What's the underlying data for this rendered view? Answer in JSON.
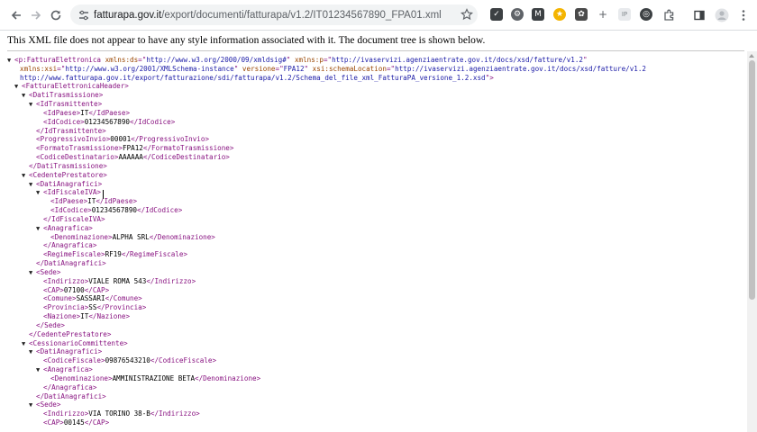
{
  "browser": {
    "url_host": "fatturapa.gov.it",
    "url_path": "/export/documenti/fatturapa/v1.2/IT01234567890_FPA01.xml",
    "icons": [
      "back-arrow-icon",
      "forward-arrow-icon",
      "reload-icon",
      "site-info-icon",
      "bookmark-star-icon",
      "extensions-puzzle-icon",
      "side-panel-icon",
      "profile-avatar-icon",
      "kebab-menu-icon"
    ]
  },
  "banner": {
    "message": "This XML file does not appear to have any style information associated with it. The document tree is shown below."
  },
  "xml": {
    "lines": [
      {
        "tw": "▼",
        "i": 0,
        "parts": [
          [
            "t",
            "<p:FatturaElettronica "
          ],
          [
            "n",
            "xmlns:ds"
          ],
          [
            "t",
            "=\""
          ],
          [
            "v",
            "http://www.w3.org/2000/09/xmldsig#"
          ],
          [
            "t",
            "\" "
          ],
          [
            "n",
            "xmlns:p"
          ],
          [
            "t",
            "=\""
          ],
          [
            "v",
            "http://ivaservizi.agenziaentrate.gov.it/docs/xsd/fatture/v1.2"
          ],
          [
            "t",
            "\""
          ]
        ]
      },
      {
        "tw": "",
        "i": 0,
        "parts": [
          [
            "n",
            "xmlns:xsi"
          ],
          [
            "t",
            "=\""
          ],
          [
            "v",
            "http://www.w3.org/2001/XMLSchema-instance"
          ],
          [
            "t",
            "\" "
          ],
          [
            "n",
            "versione"
          ],
          [
            "t",
            "=\""
          ],
          [
            "v",
            "FPA12"
          ],
          [
            "t",
            "\" "
          ],
          [
            "n",
            "xsi:schemaLocation"
          ],
          [
            "t",
            "=\""
          ],
          [
            "v",
            "http://ivaservizi.agenziaentrate.gov.it/docs/xsd/fatture/v1.2"
          ]
        ]
      },
      {
        "tw": "",
        "i": 0,
        "parts": [
          [
            "v",
            "http://www.fatturapa.gov.it/export/fatturazione/sdi/fatturapa/v1.2/Schema_del_file_xml_FatturaPA_versione_1.2.xsd"
          ],
          [
            "t",
            "\">"
          ]
        ]
      },
      {
        "tw": "▼",
        "i": 1,
        "parts": [
          [
            "t",
            "<FatturaElettronicaHeader>"
          ]
        ]
      },
      {
        "tw": "▼",
        "i": 2,
        "parts": [
          [
            "t",
            "<DatiTrasmissione>"
          ]
        ]
      },
      {
        "tw": "▼",
        "i": 3,
        "parts": [
          [
            "t",
            "<IdTrasmittente>"
          ]
        ]
      },
      {
        "tw": "",
        "i": 4,
        "parts": [
          [
            "t",
            "<IdPaese>"
          ],
          [
            "x",
            "IT"
          ],
          [
            "t",
            "</IdPaese>"
          ]
        ]
      },
      {
        "tw": "",
        "i": 4,
        "parts": [
          [
            "t",
            "<IdCodice>"
          ],
          [
            "x",
            "01234567890"
          ],
          [
            "t",
            "</IdCodice>"
          ]
        ]
      },
      {
        "tw": "",
        "i": 3,
        "parts": [
          [
            "t",
            "</IdTrasmittente>"
          ]
        ]
      },
      {
        "tw": "",
        "i": 3,
        "parts": [
          [
            "t",
            "<ProgressivoInvio>"
          ],
          [
            "x",
            "00001"
          ],
          [
            "t",
            "</ProgressivoInvio>"
          ]
        ]
      },
      {
        "tw": "",
        "i": 3,
        "parts": [
          [
            "t",
            "<FormatoTrasmissione>"
          ],
          [
            "x",
            "FPA12"
          ],
          [
            "t",
            "</FormatoTrasmissione>"
          ]
        ]
      },
      {
        "tw": "",
        "i": 3,
        "parts": [
          [
            "t",
            "<CodiceDestinatario>"
          ],
          [
            "x",
            "AAAAAA"
          ],
          [
            "t",
            "</CodiceDestinatario>"
          ]
        ]
      },
      {
        "tw": "",
        "i": 2,
        "parts": [
          [
            "t",
            "</DatiTrasmissione>"
          ]
        ]
      },
      {
        "tw": "▼",
        "i": 2,
        "parts": [
          [
            "t",
            "<CedentePrestatore>"
          ]
        ]
      },
      {
        "tw": "▼",
        "i": 3,
        "parts": [
          [
            "t",
            "<DatiAnagrafici>"
          ]
        ]
      },
      {
        "tw": "▼",
        "i": 4,
        "parts": [
          [
            "t",
            "<IdFiscaleIVA>"
          ]
        ]
      },
      {
        "tw": "",
        "i": 5,
        "parts": [
          [
            "t",
            "<IdPaese>"
          ],
          [
            "x",
            "IT"
          ],
          [
            "t",
            "</IdPaese>"
          ]
        ]
      },
      {
        "tw": "",
        "i": 5,
        "parts": [
          [
            "t",
            "<IdCodice>"
          ],
          [
            "x",
            "01234567890"
          ],
          [
            "t",
            "</IdCodice>"
          ]
        ]
      },
      {
        "tw": "",
        "i": 4,
        "parts": [
          [
            "t",
            "</IdFiscaleIVA>"
          ]
        ]
      },
      {
        "tw": "▼",
        "i": 4,
        "parts": [
          [
            "t",
            "<Anagrafica>"
          ]
        ]
      },
      {
        "tw": "",
        "i": 5,
        "parts": [
          [
            "t",
            "<Denominazione>"
          ],
          [
            "x",
            "ALPHA SRL"
          ],
          [
            "t",
            "</Denominazione>"
          ]
        ]
      },
      {
        "tw": "",
        "i": 4,
        "parts": [
          [
            "t",
            "</Anagrafica>"
          ]
        ]
      },
      {
        "tw": "",
        "i": 4,
        "parts": [
          [
            "t",
            "<RegimeFiscale>"
          ],
          [
            "x",
            "RF19"
          ],
          [
            "t",
            "</RegimeFiscale>"
          ]
        ]
      },
      {
        "tw": "",
        "i": 3,
        "parts": [
          [
            "t",
            "</DatiAnagrafici>"
          ]
        ]
      },
      {
        "tw": "▼",
        "i": 3,
        "parts": [
          [
            "t",
            "<Sede>"
          ]
        ]
      },
      {
        "tw": "",
        "i": 4,
        "parts": [
          [
            "t",
            "<Indirizzo>"
          ],
          [
            "x",
            "VIALE ROMA 543"
          ],
          [
            "t",
            "</Indirizzo>"
          ]
        ]
      },
      {
        "tw": "",
        "i": 4,
        "parts": [
          [
            "t",
            "<CAP>"
          ],
          [
            "x",
            "07100"
          ],
          [
            "t",
            "</CAP>"
          ]
        ]
      },
      {
        "tw": "",
        "i": 4,
        "parts": [
          [
            "t",
            "<Comune>"
          ],
          [
            "x",
            "SASSARI"
          ],
          [
            "t",
            "</Comune>"
          ]
        ]
      },
      {
        "tw": "",
        "i": 4,
        "parts": [
          [
            "t",
            "<Provincia>"
          ],
          [
            "x",
            "SS"
          ],
          [
            "t",
            "</Provincia>"
          ]
        ]
      },
      {
        "tw": "",
        "i": 4,
        "parts": [
          [
            "t",
            "<Nazione>"
          ],
          [
            "x",
            "IT"
          ],
          [
            "t",
            "</Nazione>"
          ]
        ]
      },
      {
        "tw": "",
        "i": 3,
        "parts": [
          [
            "t",
            "</Sede>"
          ]
        ]
      },
      {
        "tw": "",
        "i": 2,
        "parts": [
          [
            "t",
            "</CedentePrestatore>"
          ]
        ]
      },
      {
        "tw": "▼",
        "i": 2,
        "parts": [
          [
            "t",
            "<CessionarioCommittente>"
          ]
        ]
      },
      {
        "tw": "▼",
        "i": 3,
        "parts": [
          [
            "t",
            "<DatiAnagrafici>"
          ]
        ]
      },
      {
        "tw": "",
        "i": 4,
        "parts": [
          [
            "t",
            "<CodiceFiscale>"
          ],
          [
            "x",
            "09876543210"
          ],
          [
            "t",
            "</CodiceFiscale>"
          ]
        ]
      },
      {
        "tw": "▼",
        "i": 4,
        "parts": [
          [
            "t",
            "<Anagrafica>"
          ]
        ]
      },
      {
        "tw": "",
        "i": 5,
        "parts": [
          [
            "t",
            "<Denominazione>"
          ],
          [
            "x",
            "AMMINISTRAZIONE BETA"
          ],
          [
            "t",
            "</Denominazione>"
          ]
        ]
      },
      {
        "tw": "",
        "i": 4,
        "parts": [
          [
            "t",
            "</Anagrafica>"
          ]
        ]
      },
      {
        "tw": "",
        "i": 3,
        "parts": [
          [
            "t",
            "</DatiAnagrafici>"
          ]
        ]
      },
      {
        "tw": "▼",
        "i": 3,
        "parts": [
          [
            "t",
            "<Sede>"
          ]
        ]
      },
      {
        "tw": "",
        "i": 4,
        "parts": [
          [
            "t",
            "<Indirizzo>"
          ],
          [
            "x",
            "VIA TORINO 38-B"
          ],
          [
            "t",
            "</Indirizzo>"
          ]
        ]
      },
      {
        "tw": "",
        "i": 4,
        "parts": [
          [
            "t",
            "<CAP>"
          ],
          [
            "x",
            "00145"
          ],
          [
            "t",
            "</CAP>"
          ]
        ]
      }
    ]
  }
}
